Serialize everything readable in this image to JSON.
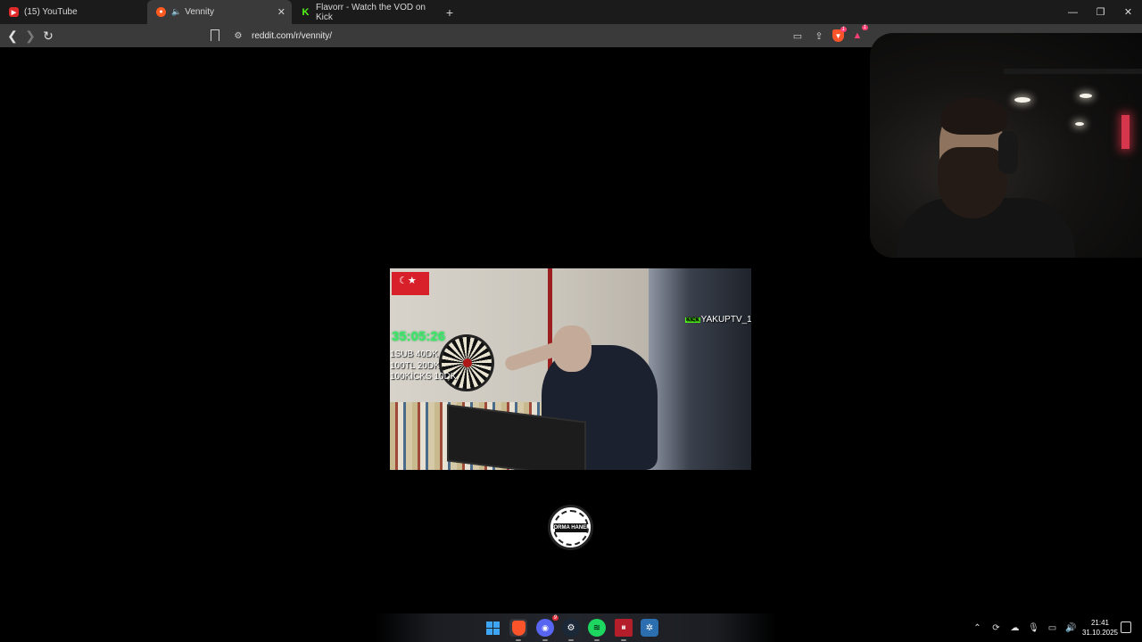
{
  "browser": {
    "tabs": [
      {
        "label": "(15) YouTube",
        "active": false,
        "favicon": "youtube-icon"
      },
      {
        "label": "Vennity",
        "active": true,
        "favicon": "reddit-icon",
        "muted_icon": "speaker-icon"
      },
      {
        "label": "Flavorr - Watch the VOD on Kick",
        "active": false,
        "favicon": "kick-icon"
      }
    ],
    "new_tab_symbol": "+",
    "url": "reddit.com/r/vennity/",
    "shield_badge": "1",
    "rewards_badge": "1"
  },
  "video": {
    "timer": "35:05:26",
    "rules": [
      "1SUB 40DK",
      "100TL 20DK",
      "100KİCKS 10DK"
    ],
    "kick_logo": "KICK",
    "streamer_tag": "YAKUPTV_1"
  },
  "logo": {
    "text": "FORMA HANEM"
  },
  "taskbar": {
    "discord_badge": "9",
    "clock_time": "21:41",
    "clock_date": "31.10.2025"
  },
  "colors": {
    "kick_green": "#53fc18",
    "timer_green": "#3ee86a",
    "brave_orange": "#fb542b",
    "active_tab": "#3a3a3a"
  }
}
